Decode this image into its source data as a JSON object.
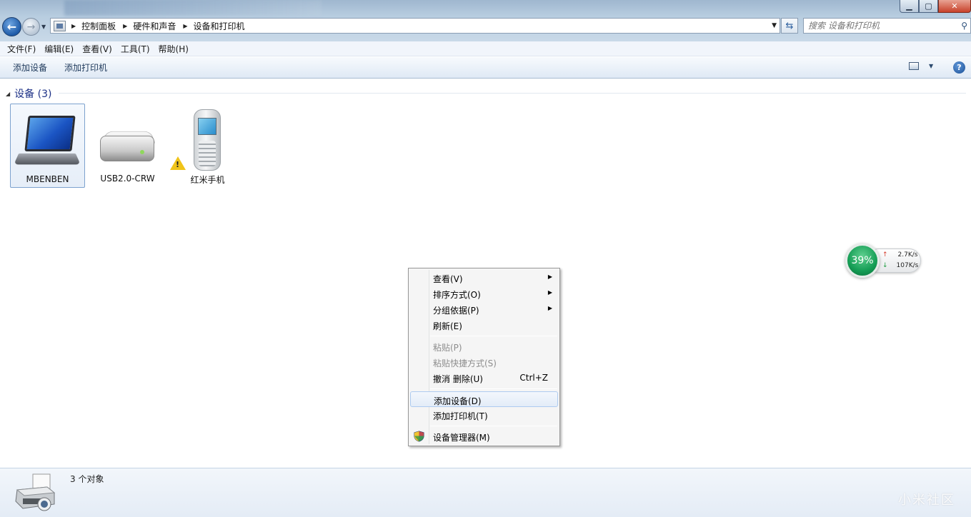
{
  "address": {
    "breadcrumbs": [
      "控制面板",
      "硬件和声音",
      "设备和打印机"
    ]
  },
  "search": {
    "placeholder": "搜索 设备和打印机"
  },
  "menubar": [
    "文件(F)",
    "编辑(E)",
    "查看(V)",
    "工具(T)",
    "帮助(H)"
  ],
  "toolbar": {
    "add_device": "添加设备",
    "add_printer": "添加打印机"
  },
  "group": {
    "title": "设备 (3)"
  },
  "devices": [
    {
      "label": "MBENBEN",
      "icon": "laptop-icon",
      "selected": true
    },
    {
      "label": "USB2.0-CRW",
      "icon": "usb-drive-icon"
    },
    {
      "label": "红米手机",
      "icon": "phone-icon",
      "warning": true
    }
  ],
  "network_widget": {
    "percent": "39%",
    "upload": "2.7K/s",
    "download": "107K/s"
  },
  "context_menu": {
    "items": [
      {
        "label": "查看(V)",
        "submenu": true
      },
      {
        "label": "排序方式(O)",
        "submenu": true
      },
      {
        "label": "分组依据(P)",
        "submenu": true
      },
      {
        "label": "刷新(E)"
      },
      {
        "label": "粘贴(P)",
        "disabled": true
      },
      {
        "label": "粘贴快捷方式(S)",
        "disabled": true
      },
      {
        "label": "撤消 删除(U)",
        "shortcut": "Ctrl+Z"
      },
      {
        "label": "添加设备(D)",
        "highlighted": true
      },
      {
        "label": "添加打印机(T)"
      },
      {
        "label": "设备管理器(M)",
        "icon": "shield-icon"
      }
    ]
  },
  "status": {
    "count": "3 个对象"
  },
  "watermark": "小米社区",
  "colors": {
    "accent": "#1e3287",
    "network_green": "#159d55",
    "warning": "#f0c419"
  }
}
